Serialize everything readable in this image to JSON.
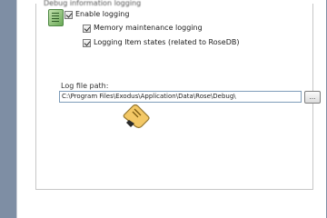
{
  "logging_group": {
    "caption": "Debug information logging",
    "enable_logging": {
      "label": "Enable logging",
      "checked": true
    },
    "memory_logging": {
      "label": "Memory maintenance logging",
      "checked": true
    },
    "states_logging": {
      "label": "Logging Item states (related to RoseDB)",
      "checked": true
    }
  },
  "log_path": {
    "label": "Log file path:",
    "value": "C:\\Program Files\\Exodus\\Application\\Data\\Rose\\Debug\\",
    "browse_label": "..."
  },
  "icons": {
    "log_icon": "log-settings-icon",
    "cursor": "hand-pointer-icon"
  },
  "colors": {
    "window_edge": "#7e8ea4",
    "input_border": "#7f9db9",
    "icon_green": "#6aa957",
    "cursor_fill": "#f2c45a"
  }
}
